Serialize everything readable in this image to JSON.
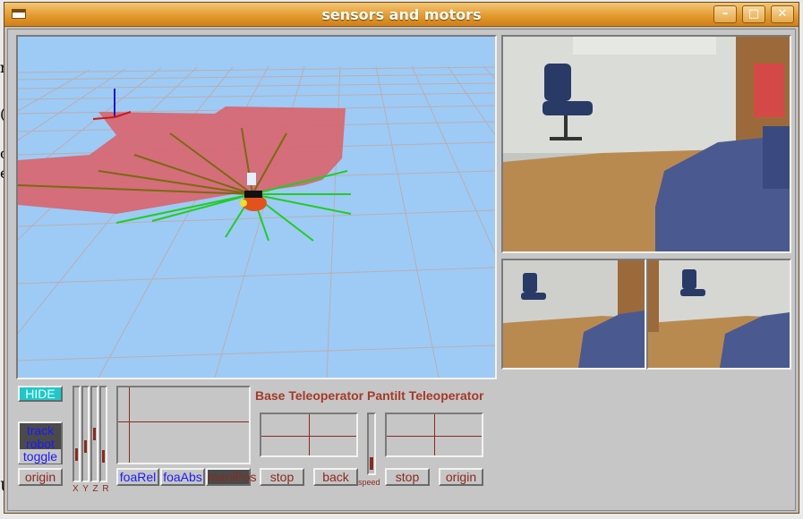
{
  "window": {
    "title": "sensors and motors",
    "controls": {
      "minimize": "–",
      "maximize": "□",
      "close": "✕"
    }
  },
  "background_fragments": [
    "n",
    "(",
    "o",
    "e",
    "c",
    "p",
    "(",
    "a",
    "(",
    "f",
    "i",
    "i",
    "U"
  ],
  "left_controls": {
    "hide_label": "HIDE",
    "track_label": "track",
    "robot_label": "robot",
    "toggle_label": "toggle",
    "origin_label": "origin"
  },
  "axes_sliders": {
    "label": "X Y Z R",
    "levels": [
      0.25,
      0.35,
      0.5,
      0.22
    ]
  },
  "foa": {
    "foa_rel_label": "foaRel",
    "foa_abs_label": "foaAbs",
    "mani_pos_label": "maniPos"
  },
  "teleop": {
    "header": "Base Teleoperator Pantilt Teleoperator",
    "base_stop": "stop",
    "base_back": "back",
    "speed_label": "speed",
    "speed_level": 0.08,
    "pantilt_stop": "stop",
    "pantilt_origin": "origin"
  },
  "views": {
    "world_view": "3d-world",
    "camera_main": "camera-main",
    "camera_left": "camera-left",
    "camera_right": "camera-right"
  },
  "colors": {
    "titlebar": "#e39b2f",
    "accent_text": "#8b2a1e",
    "hide_button": "#1ec8c8",
    "sky": "#9dcbf5",
    "occupied": "#d9666f"
  }
}
